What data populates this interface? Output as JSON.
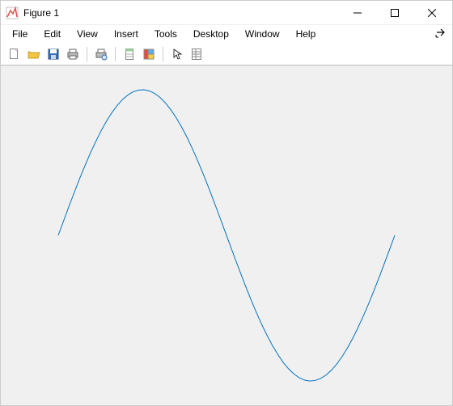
{
  "window": {
    "title": "Figure 1"
  },
  "menu": {
    "items": [
      "File",
      "Edit",
      "View",
      "Insert",
      "Tools",
      "Desktop",
      "Window",
      "Help"
    ]
  },
  "toolbar": {
    "icons": [
      "new-figure-icon",
      "open-file-icon",
      "save-icon",
      "print-icon",
      "sep",
      "print-preview-icon",
      "sep",
      "data-cursor-icon",
      "color-icon",
      "sep",
      "pointer-icon",
      "inspector-icon"
    ]
  },
  "chart_data": {
    "type": "line",
    "title": "",
    "xlabel": "",
    "ylabel": "",
    "xlim": [
      0,
      6.283185
    ],
    "ylim": [
      -1,
      1
    ],
    "x": [
      0,
      0.1,
      0.2,
      0.3,
      0.4,
      0.5,
      0.6,
      0.7,
      0.8,
      0.9,
      1,
      1.1,
      1.2,
      1.3,
      1.4,
      1.5,
      1.6,
      1.7,
      1.8,
      1.9,
      2,
      2.1,
      2.2,
      2.3,
      2.4,
      2.5,
      2.6,
      2.7,
      2.8,
      2.9,
      3,
      3.1,
      3.2,
      3.3,
      3.4,
      3.5,
      3.6,
      3.7,
      3.8,
      3.9,
      4,
      4.1,
      4.2,
      4.3,
      4.4,
      4.5,
      4.6,
      4.7,
      4.8,
      4.9,
      5,
      5.1,
      5.2,
      5.3,
      5.4,
      5.5,
      5.6,
      5.7,
      5.8,
      5.9,
      6,
      6.1,
      6.2,
      6.283185
    ],
    "y": [
      0,
      0.0998,
      0.1987,
      0.2955,
      0.3894,
      0.4794,
      0.5646,
      0.6442,
      0.7174,
      0.7833,
      0.8415,
      0.8912,
      0.932,
      0.9636,
      0.9854,
      0.9975,
      0.9996,
      0.9917,
      0.9738,
      0.9463,
      0.9093,
      0.8632,
      0.8085,
      0.7457,
      0.6755,
      0.5985,
      0.5155,
      0.4274,
      0.335,
      0.2392,
      0.1411,
      0.0416,
      -0.0584,
      -0.1577,
      -0.2555,
      -0.3508,
      -0.4425,
      -0.5298,
      -0.6119,
      -0.6878,
      -0.7568,
      -0.8183,
      -0.8716,
      -0.9162,
      -0.9516,
      -0.9775,
      -0.9937,
      -0.9999,
      -0.9962,
      -0.9825,
      -0.9589,
      -0.9258,
      -0.8835,
      -0.8323,
      -0.7728,
      -0.7055,
      -0.6313,
      -0.5507,
      -0.4646,
      -0.3739,
      -0.2794,
      -0.1822,
      -0.0831,
      0
    ]
  },
  "colors": {
    "line": "#0072BD",
    "plot_bg": "#f0f0f0"
  }
}
